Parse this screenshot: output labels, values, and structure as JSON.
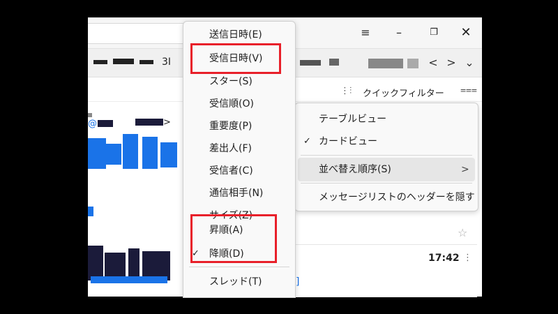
{
  "window": {
    "controls": {
      "menu": "≡",
      "minimize": "–",
      "restore": "❐",
      "close": "✕"
    }
  },
  "tabs": {
    "partial_text": "3I",
    "nav_left": "<",
    "nav_right": ">",
    "nav_down": "⌄"
  },
  "toolbar": {
    "quick_filter_label": "クイックフィルター"
  },
  "sort_menu": {
    "items": [
      {
        "label": "送信日時(E)"
      },
      {
        "label": "受信日時(V)"
      },
      {
        "label": "スター(S)"
      },
      {
        "label": "受信順(O)"
      },
      {
        "label": "重要度(P)"
      },
      {
        "label": "差出人(F)"
      },
      {
        "label": "受信者(C)"
      },
      {
        "label": "通信相手(N)"
      },
      {
        "label": "サイズ(Z)"
      }
    ],
    "order_items": [
      {
        "label": "昇順(A)",
        "checked": false
      },
      {
        "label": "降順(D)",
        "checked": true
      }
    ],
    "thread_item": {
      "label": "スレッド(T)"
    }
  },
  "context_menu": {
    "items": [
      {
        "label": "テーブルビュー",
        "checked": false
      },
      {
        "label": "カードビュー",
        "checked": true
      },
      {
        "label": "並べ替え順序(S)",
        "submenu": true
      },
      {
        "label": "メッセージリストのヘッダーを隠す"
      }
    ],
    "check_glyph": "✓",
    "submenu_glyph": ">"
  },
  "message_list": {
    "card_time": "17:42",
    "card_more": "⋮",
    "link_fragment": "]"
  },
  "highlight_color": "#e8202a"
}
